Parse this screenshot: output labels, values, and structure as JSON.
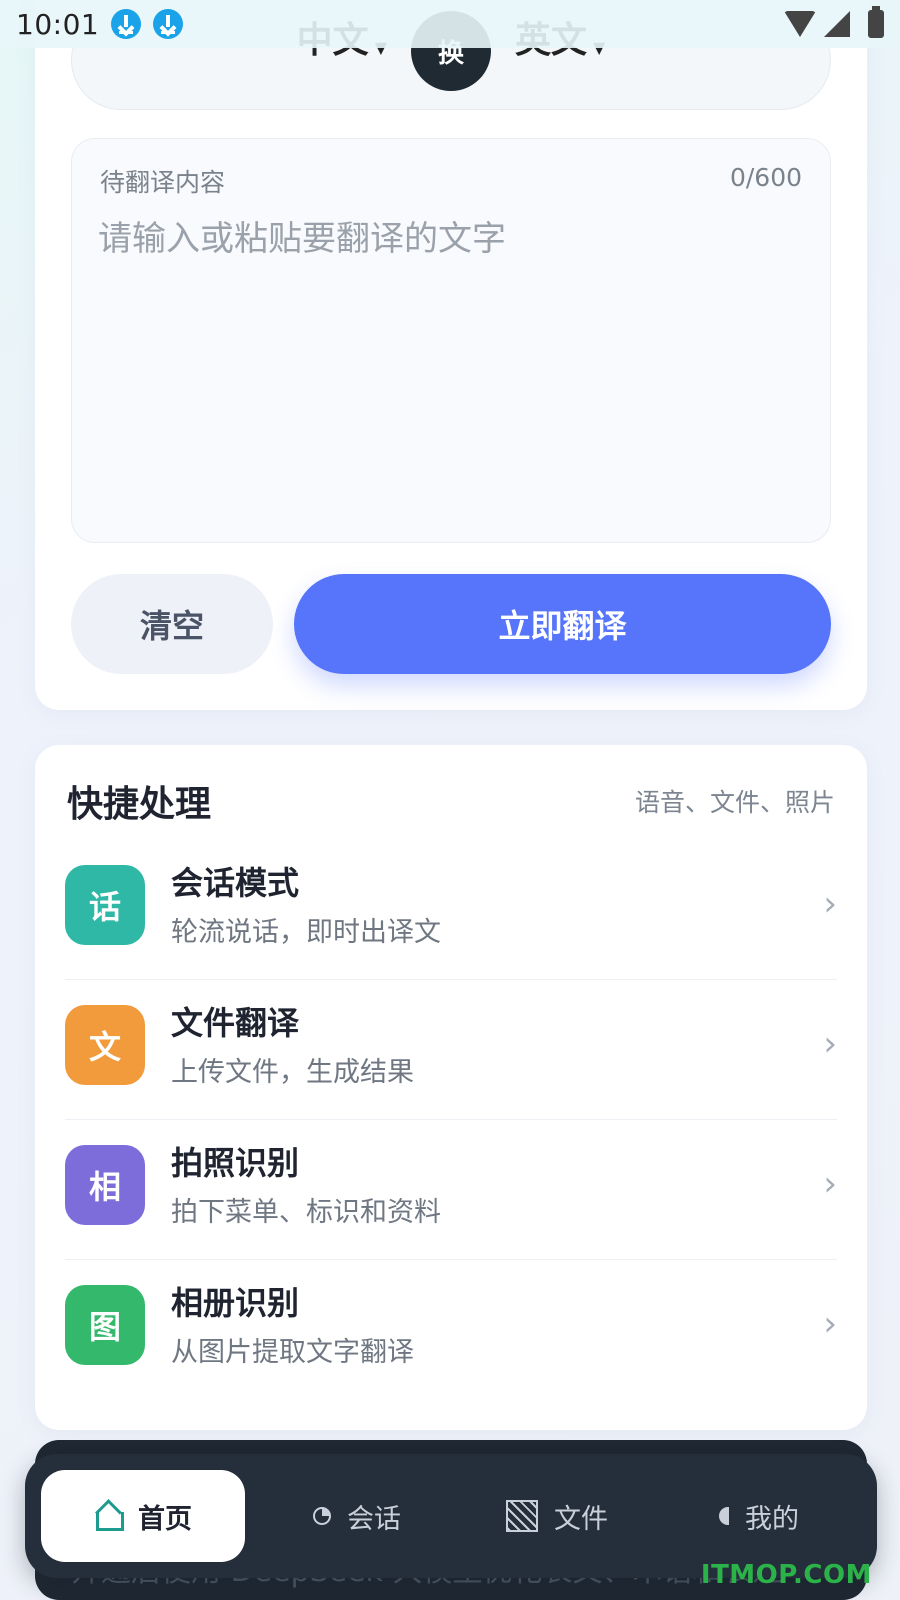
{
  "status": {
    "time": "10:01"
  },
  "lang": {
    "source": "中文",
    "target": "英文",
    "swap_label": "换"
  },
  "input": {
    "title": "待翻译内容",
    "count": "0/600",
    "placeholder": "请输入或粘贴要翻译的文字",
    "value": ""
  },
  "actions": {
    "clear_label": "清空",
    "translate_label": "立即翻译"
  },
  "quick": {
    "title": "快捷处理",
    "subtitle": "语音、文件、照片",
    "items": [
      {
        "icon_char": "话",
        "icon_color": "#2fb8a6",
        "name": "会话模式",
        "desc": "轮流说话，即时出译文"
      },
      {
        "icon_char": "文",
        "icon_color": "#f19b3c",
        "name": "文件翻译",
        "desc": "上传文件，生成结果"
      },
      {
        "icon_char": "相",
        "icon_color": "#7d6ddb",
        "name": "拍照识别",
        "desc": "拍下菜单、标识和资料"
      },
      {
        "icon_char": "图",
        "icon_color": "#34b86c",
        "name": "相册识别",
        "desc": "从图片提取文字翻译"
      }
    ]
  },
  "banner": {
    "text": "开通后使用 DeepSeek 大模型优化长文、术语和表达"
  },
  "nav": {
    "items": [
      {
        "label": "首页",
        "icon": "home-icon",
        "active": true
      },
      {
        "label": "会话",
        "icon": "chat-icon",
        "active": false
      },
      {
        "label": "文件",
        "icon": "file-icon",
        "active": false
      },
      {
        "label": "我的",
        "icon": "profile-icon",
        "active": false
      }
    ]
  },
  "watermark": "ITMOP.COM",
  "colors": {
    "accent": "#5675fa",
    "nav_bg": "#252f3b",
    "home_icon": "#1e9b8f"
  }
}
